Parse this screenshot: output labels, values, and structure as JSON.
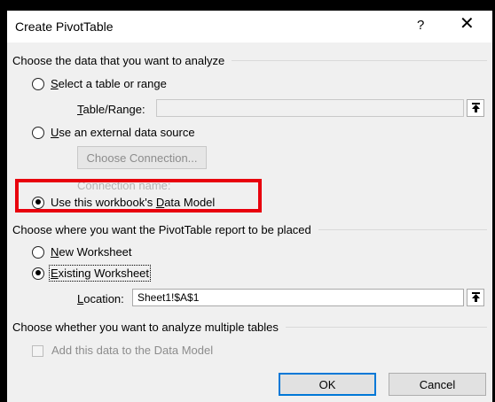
{
  "dialog": {
    "title": "Create PivotTable",
    "help_glyph": "?",
    "close_glyph": "✕"
  },
  "source_section": {
    "heading": "Choose the data that you want to analyze",
    "options": {
      "table_range": {
        "label_prefix": "",
        "label_access": "S",
        "label_rest": "elect a table or range",
        "selected": false,
        "field_label_access": "T",
        "field_label_rest": "able/Range:",
        "field_value": ""
      },
      "external": {
        "label_access": "U",
        "label_rest": "se an external data source",
        "selected": false,
        "button_label": "Choose Connection...",
        "connection_name_label": "Connection name:"
      },
      "data_model": {
        "label_before": "Use this workbook's ",
        "label_access": "D",
        "label_rest": "ata Model",
        "selected": true
      }
    }
  },
  "destination_section": {
    "heading": "Choose where you want the PivotTable report to be placed",
    "new_worksheet": {
      "label_access": "N",
      "label_rest": "ew Worksheet",
      "selected": false
    },
    "existing_worksheet": {
      "label_access": "E",
      "label_rest": "xisting Worksheet",
      "selected": true
    },
    "location": {
      "label_access": "L",
      "label_rest": "ocation:",
      "value": "Sheet1!$A$1"
    }
  },
  "multiple_section": {
    "heading": "Choose whether you want to analyze multiple tables",
    "checkbox_label": "Add this data to the Data Model",
    "checked": false,
    "enabled": false
  },
  "footer": {
    "ok_label": "OK",
    "cancel_label": "Cancel"
  },
  "colors": {
    "highlight_border": "#e8000d",
    "default_button_border": "#0078d7",
    "dialog_background": "#f0f0f0"
  }
}
